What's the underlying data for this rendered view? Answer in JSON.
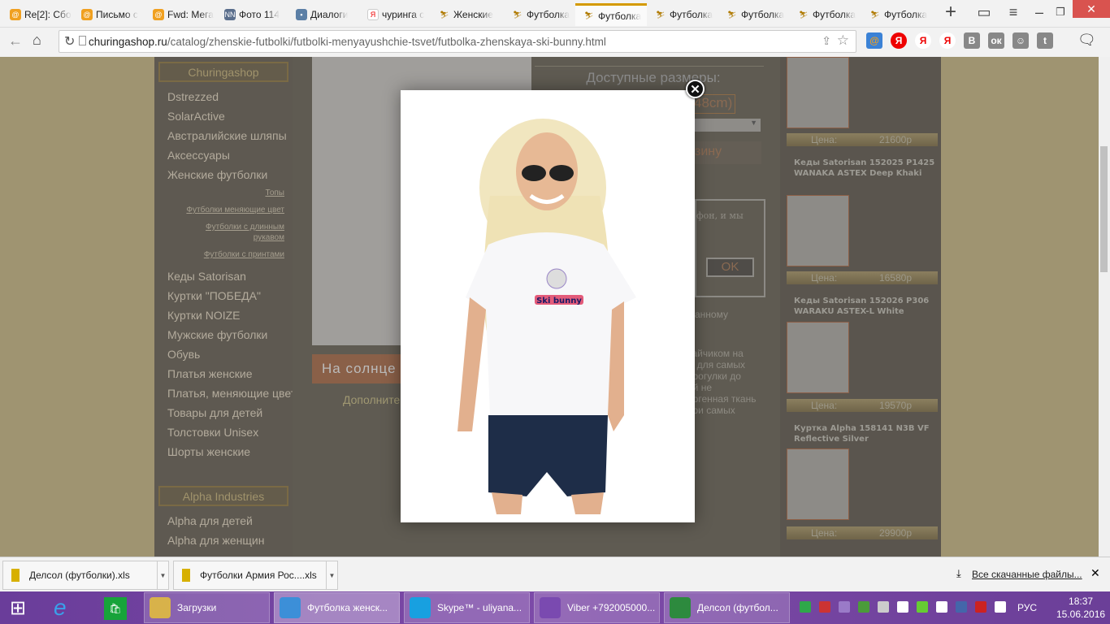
{
  "browser": {
    "tabs": [
      {
        "label": "Re[2]: Сбо",
        "icon": "mail-ru-icon"
      },
      {
        "label": "Письмо с",
        "icon": "mail-ru-icon"
      },
      {
        "label": "Fwd: Мега",
        "icon": "mail-ru-icon"
      },
      {
        "label": "Фото 114",
        "icon": "nn-icon"
      },
      {
        "label": "Диалоги",
        "icon": "vk-dialog-icon"
      },
      {
        "label": "чуринга с",
        "icon": "yandex-icon"
      },
      {
        "label": "Женские",
        "icon": "churinga-icon"
      },
      {
        "label": "Футболка",
        "icon": "churinga-icon"
      },
      {
        "label": "Футболка",
        "icon": "churinga-icon",
        "active": true
      },
      {
        "label": "Футболка",
        "icon": "churinga-icon"
      },
      {
        "label": "Футболка",
        "icon": "churinga-icon"
      },
      {
        "label": "Футболка",
        "icon": "churinga-icon"
      },
      {
        "label": "Футболка",
        "icon": "churinga-icon"
      }
    ],
    "url_domain": "churingashop.ru",
    "url_path": "/catalog/zhenskie-futbolki/futbolki-menyayushchie-tsvet/futbolka-zhenskaya-ski-bunny.html",
    "extensions": [
      "@",
      "Я",
      "Я",
      "Я",
      "В",
      "ок",
      "☺",
      "t"
    ]
  },
  "sidebar": {
    "section1_title": "Churingashop",
    "items": [
      "Dstrezzed",
      "SolarActive",
      "Австралийские шляпы",
      "Аксессуары",
      "Женские футболки"
    ],
    "subitems": [
      "Топы",
      "Футболки меняющие цвет",
      "Футболки с длинным рукавом",
      "Футболки с принтами"
    ],
    "items2": [
      "Кеды Satorisan",
      "Куртки \"ПОБЕДА\"",
      "Куртки NOIZE",
      "Мужские футболки",
      "Обувь",
      "Платья женские",
      "Платья, меняющие цвет",
      "Товары для детей",
      "Толстовки Unisex",
      "Шорты женские"
    ],
    "section2_title": "Alpha Industries",
    "items3": [
      "Alpha для детей",
      "Alpha для женщин"
    ]
  },
  "product": {
    "sizes_title": "Доступные размеры:",
    "size_value": "48cm)",
    "cart_fragment": "зину",
    "callback_fragment": "фон, и мы",
    "ok_label": "OK",
    "note_fragment": "анному",
    "desc_lines": [
      "зайчиком на",
      "м для самых",
      "прогулки до",
      "ой не",
      "ергенная ткань",
      "при самых"
    ],
    "banner_fragment": "На солнце",
    "extra_fragment": "Дополните"
  },
  "related": [
    {
      "name": "",
      "price_label": "Цена:",
      "price": "21600р"
    },
    {
      "name": "Кеды Satorisan 152025 P1425 WANAKA ASTEX Deep Khaki",
      "price_label": "Цена:",
      "price": "16580р"
    },
    {
      "name": "Кеды Satorisan 152026 P306 WARAKU ASTEX-L White",
      "price_label": "Цена:",
      "price": "19570р"
    },
    {
      "name": "Куртка Alpha 158141 N3B VF Reflective Silver",
      "price_label": "Цена:",
      "price": "29900р"
    }
  ],
  "modal": {
    "print_text": "Ski bunny"
  },
  "downloads": {
    "items": [
      "Делсол (футболки).xls",
      "Футболки Армия Рос....xls"
    ],
    "all_label": "Все скачанные файлы..."
  },
  "taskbar": {
    "windows": [
      "Загрузки",
      "Футболка женск...",
      "Skype™ - uliyana...",
      "Viber +792005000...",
      "Делсол (футбол..."
    ],
    "lang": "РУС",
    "time": "18:37",
    "date": "15.06.2016"
  }
}
